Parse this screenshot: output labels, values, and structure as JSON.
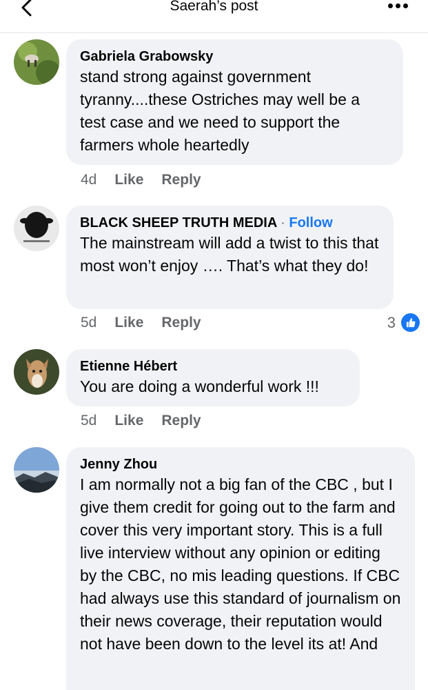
{
  "header": {
    "title": "Saerah’s post"
  },
  "comments": [
    {
      "author": "Gabriela Grabowsky",
      "text": "stand strong against government tyranny....these Ostriches may well be a test case and we need to support the farmers whole heartedly",
      "time": "4d",
      "like_label": "Like",
      "reply_label": "Reply"
    },
    {
      "author": "BLACK SHEEP TRUTH MEDIA",
      "follow_label": "Follow",
      "separator": "·",
      "text": "The mainstream will add a twist to this that most won’t enjoy …. That’s what they do!",
      "time": "5d",
      "like_label": "Like",
      "reply_label": "Reply",
      "reaction_count": "3"
    },
    {
      "author": "Etienne Hébert",
      "text": "You are doing a wonderful work !!!",
      "time": "5d",
      "like_label": "Like",
      "reply_label": "Reply"
    },
    {
      "author": "Jenny Zhou",
      "text": "I am normally not a big fan of the CBC , but I give them credit for going out to the farm and cover this very important story. This is a full live interview without any opinion or editing by the CBC, no mis leading questions. If CBC had always use this standard of journalism on their news coverage, their reputation would not have been down to the level its at! And"
    }
  ],
  "icons": {
    "back": "chevron-left-icon",
    "more": "more-horizontal-icon",
    "like_reaction": "thumbs-up-icon"
  },
  "colors": {
    "accent": "#1877f2",
    "bubble": "#f0f2f5",
    "meta_text": "#65676b"
  }
}
